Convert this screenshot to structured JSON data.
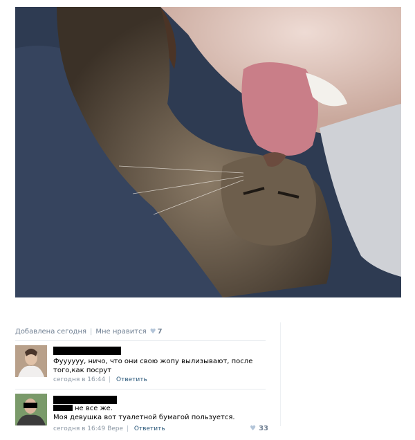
{
  "post": {
    "added_label": "Добавлена сегодня",
    "like_label": "Мне нравится",
    "like_count": "7",
    "heart_icon": "heart-icon"
  },
  "comments": [
    {
      "text": "Фууууyy, ничо, что они свою жопу вылизывают, после того,как посрут",
      "time": "сегодня в 16:44",
      "reply_label": "Ответить"
    },
    {
      "text_line1": "не все же.",
      "text_line2": "Моя девушка вот туалетной бумагой пользуется.",
      "time": "сегодня в 16:49",
      "addressee": "Вере",
      "reply_label": "Ответить",
      "likes": "33"
    }
  ],
  "colors": {
    "meta_text": "#6f7f92",
    "link": "#2b587a",
    "heart": "#b3c5d9"
  }
}
